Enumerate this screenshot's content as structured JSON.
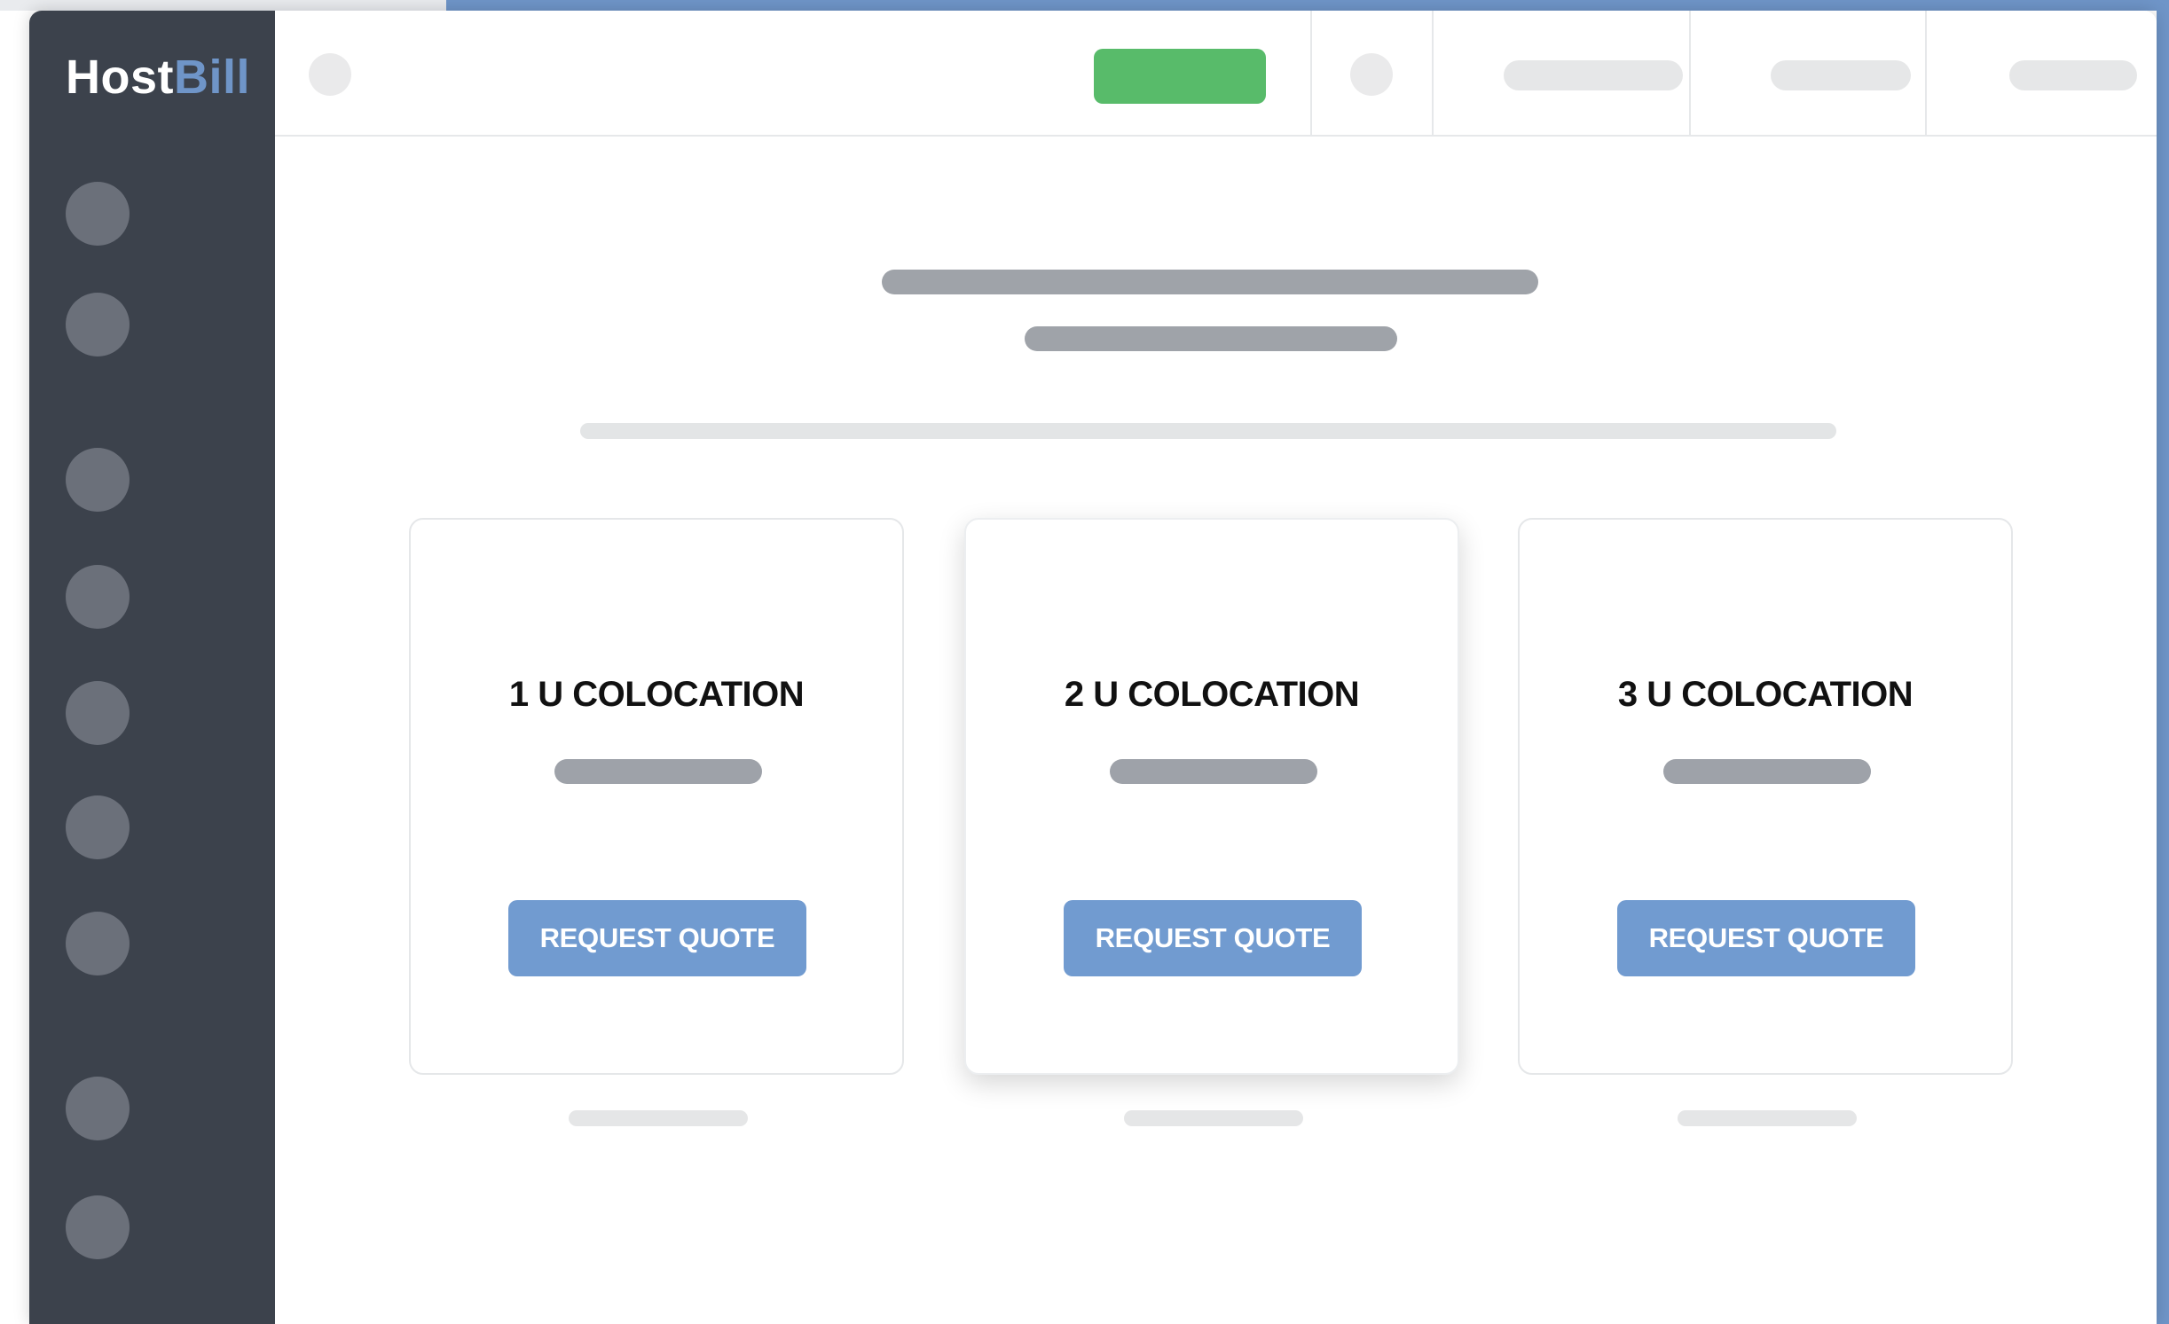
{
  "app": {
    "logo_part1": "Host",
    "logo_part2": "Bill",
    "brand_color": "#6f95c8",
    "sidebar_color": "#3c424c"
  },
  "cards": [
    {
      "title": "1 U COLOCATION",
      "button_label": "REQUEST QUOTE"
    },
    {
      "title": "2 U COLOCATION",
      "button_label": "REQUEST QUOTE"
    },
    {
      "title": "3 U COLOCATION",
      "button_label": "REQUEST QUOTE"
    }
  ],
  "colors": {
    "button": "#719bd0",
    "topbar_action": "#58bb6a"
  }
}
